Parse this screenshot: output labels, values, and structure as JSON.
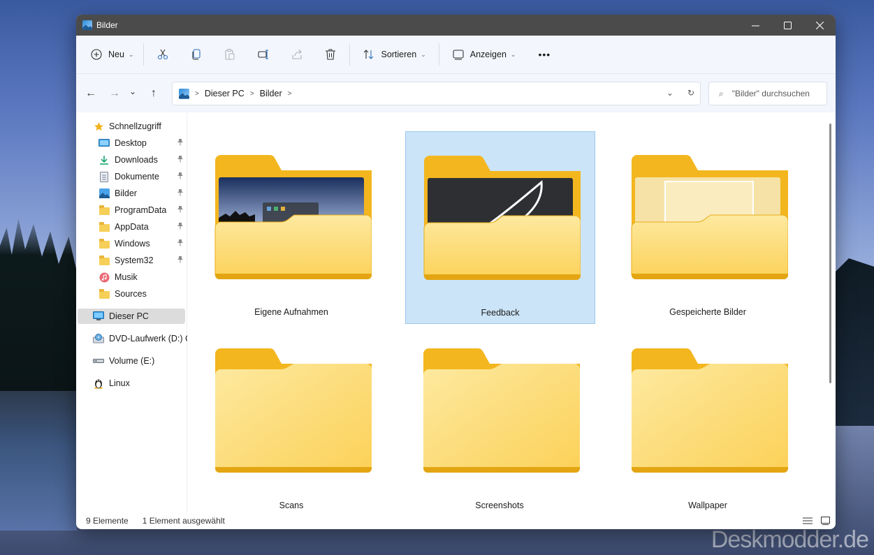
{
  "window": {
    "title": "Bilder"
  },
  "titlebar_controls": {
    "minimize": "—",
    "maximize": "☐",
    "close": "✕"
  },
  "toolbar": {
    "new_label": "Neu",
    "sort_label": "Sortieren",
    "view_label": "Anzeigen",
    "more_label": "•••"
  },
  "navigation": {
    "back": "←",
    "forward": "→",
    "recent": "⌄",
    "up": "↑"
  },
  "address": {
    "crumbs": [
      "Dieser PC",
      "Bilder"
    ],
    "dropdown": "⌄",
    "refresh": "↻"
  },
  "search": {
    "placeholder": "\"Bilder\" durchsuchen",
    "icon": "⌕"
  },
  "sidebar": {
    "quick_access": "Schnellzugriff",
    "items": [
      {
        "label": "Desktop",
        "icon": "desktop-icon",
        "pinned": true
      },
      {
        "label": "Downloads",
        "icon": "download-icon",
        "pinned": true
      },
      {
        "label": "Dokumente",
        "icon": "document-icon",
        "pinned": true
      },
      {
        "label": "Bilder",
        "icon": "pictures-icon",
        "pinned": true
      },
      {
        "label": "ProgramData",
        "icon": "folder-icon",
        "pinned": true
      },
      {
        "label": "AppData",
        "icon": "folder-icon",
        "pinned": true
      },
      {
        "label": "Windows",
        "icon": "folder-icon",
        "pinned": true
      },
      {
        "label": "System32",
        "icon": "folder-icon",
        "pinned": true
      },
      {
        "label": "Musik",
        "icon": "music-icon",
        "pinned": false
      },
      {
        "label": "Sources",
        "icon": "folder-icon",
        "pinned": false
      }
    ],
    "this_pc": "Dieser PC",
    "drives": [
      {
        "label": "DVD-Laufwerk (D:) C",
        "icon": "dvd-icon"
      },
      {
        "label": "Volume (E:)",
        "icon": "drive-icon"
      },
      {
        "label": "Linux",
        "icon": "linux-icon"
      }
    ],
    "pin_glyph": "📌"
  },
  "folders": [
    {
      "name": "Eigene Aufnahmen",
      "preview": "desktop-screenshot",
      "selected": false
    },
    {
      "name": "Feedback",
      "preview": "dark-sketch",
      "selected": true
    },
    {
      "name": "Gespeicherte Bilder",
      "preview": "light-paper",
      "selected": false
    },
    {
      "name": "Scans",
      "preview": "none",
      "selected": false
    },
    {
      "name": "Screenshots",
      "preview": "none",
      "selected": false
    },
    {
      "name": "Wallpaper",
      "preview": "none",
      "selected": false
    }
  ],
  "status": {
    "count": "9 Elemente",
    "selection": "1 Element ausgewählt"
  },
  "watermark": "Deskmodder.de",
  "colors": {
    "titlebar": "#4b4b4b",
    "toolbar_bg": "#f3f6fc",
    "selection_bg": "#cce4f7",
    "folder_back": "#f3b61f",
    "folder_front": "#fde07a"
  }
}
